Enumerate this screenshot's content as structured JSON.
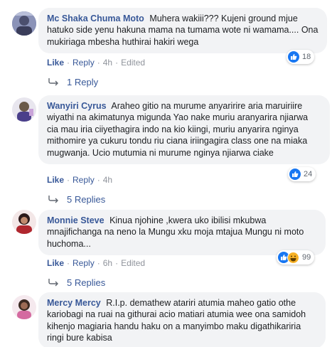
{
  "actions": {
    "like": "Like",
    "reply": "Reply",
    "dot": "·",
    "edited": "Edited"
  },
  "colors": {
    "name_link": "#385898",
    "bubble_bg": "#f2f3f5",
    "meta_gray": "#90949c",
    "like_blue": "#1877f2"
  },
  "comments": [
    {
      "author": "Mc Shaka Chuma Moto",
      "text": "Muhera wakiii??? Kujeni ground mjue hatuko side yenu hakuna mama na tumama wote ni wamama.... Ona mukiriaga mbesha huthirai hakiri wega",
      "reaction_count": "18",
      "reaction_icons": [
        "like-icon"
      ],
      "time": "4h",
      "edited": true,
      "replies_label": "1 Reply"
    },
    {
      "author": "Wanyiri Cyrus",
      "text": "Araheo gitio na murume anyaririre aria maruiriire wiyathi na akimatunya migunda Yao nake muriu aranyarira njiarwa cia mau iria ciiyethagira indo na kio kiingi, muriu anyarira nginya mithomire ya cukuru tondu riu ciana iriingagira class one na miaka mugwanja. Ucio mutumia ni murume nginya njiarwa ciake",
      "reaction_count": "24",
      "reaction_icons": [
        "like-icon"
      ],
      "time": "4h",
      "edited": false,
      "replies_label": "5 Replies"
    },
    {
      "author": "Monnie Steve",
      "text": "Kinua njohine ,kwera uko ibilisi mkubwa mnajifichanga na neno la Mungu xku moja mtajua Mungu ni moto huchoma...",
      "reaction_count": "99",
      "reaction_icons": [
        "like-icon",
        "haha-icon"
      ],
      "time": "6h",
      "edited": true,
      "replies_label": "5 Replies"
    },
    {
      "author": "Mercy Mercy",
      "text": "R.I.p. demathew atariri atumia maheo gatio othe kariobagi na ruai na githurai acio matiari atumia wee ona samidoh kihenjo magiaria handu haku on a manyimbo maku digathikariria ringi bure kabisa",
      "reaction_count": "",
      "reaction_icons": [],
      "time": "",
      "edited": false,
      "replies_label": ""
    }
  ]
}
